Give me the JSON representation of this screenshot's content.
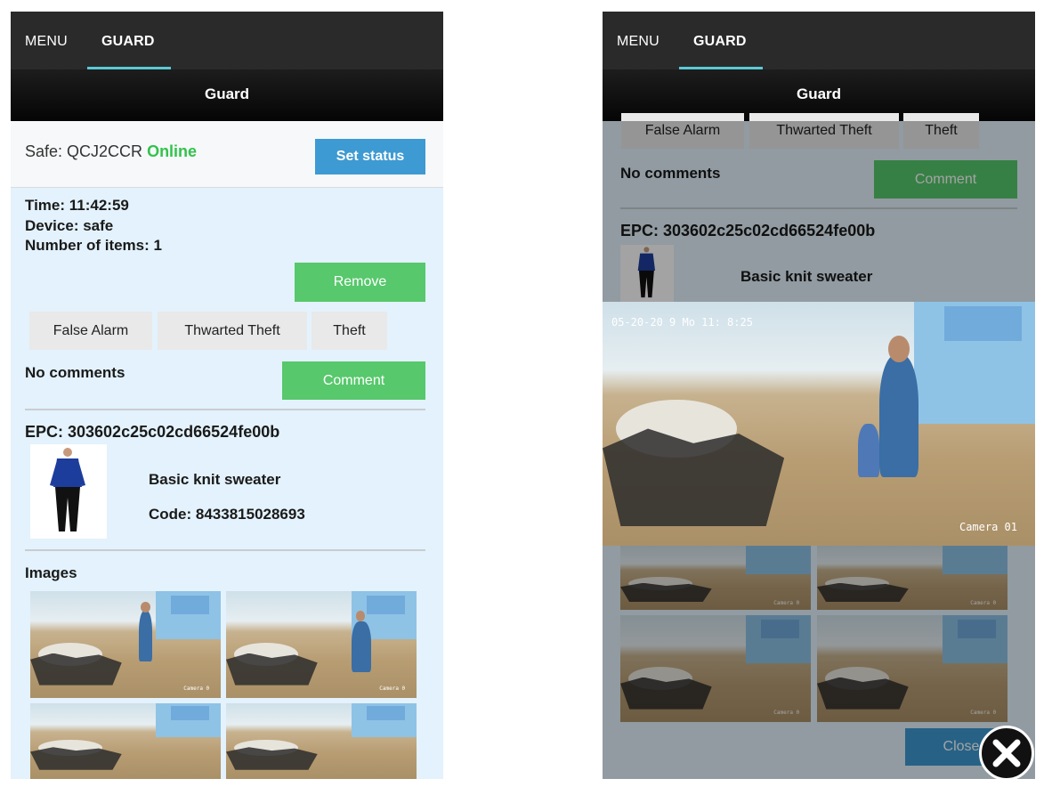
{
  "tabs": {
    "menu": "MENU",
    "guard": "GUARD"
  },
  "title": "Guard",
  "safe": {
    "label": "Safe: QCJ2CCR",
    "status": "Online",
    "set_status_button": "Set status"
  },
  "event": {
    "time": "Time: 11:42:59",
    "device": "Device: safe",
    "items": "Number of items: 1",
    "remove_button": "Remove"
  },
  "classify": {
    "false_alarm": "False Alarm",
    "thwarted": "Thwarted Theft",
    "theft": "Theft"
  },
  "comments": {
    "text": "No comments",
    "button": "Comment"
  },
  "item": {
    "epc": "EPC: 303602c25c02cd66524fe00b",
    "name": "Basic knit sweater",
    "code": "Code: 8433815028693"
  },
  "images": {
    "heading": "Images",
    "cam_label": "Camera 0"
  },
  "viewer": {
    "timestamp": "05-20-20 9 Mo 11: 8:25",
    "camera": "Camera 01",
    "close_button": "Close"
  },
  "colors": {
    "accent_blue": "#3e9ad2",
    "accent_green": "#57c86c",
    "online": "#33c24d",
    "tab_underline": "#5bc9d6"
  }
}
